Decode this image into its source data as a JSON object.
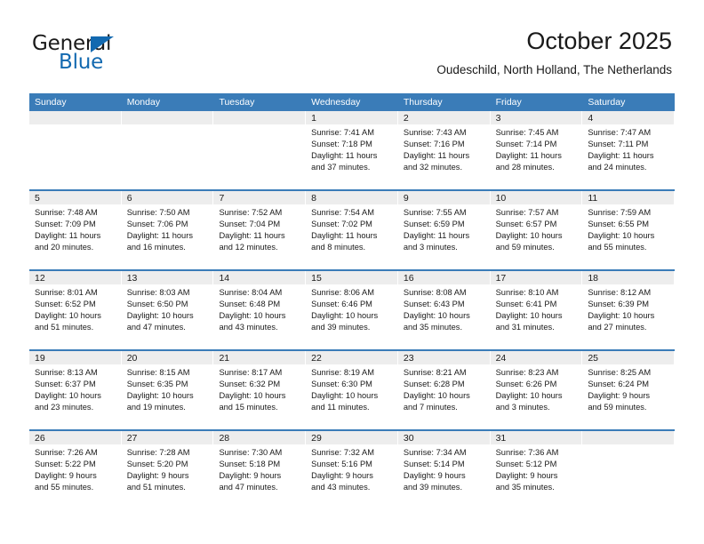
{
  "brand": {
    "name_part1": "General",
    "name_part2": "Blue",
    "accent_color": "#1269b0"
  },
  "header": {
    "title": "October 2025",
    "subtitle": "Oudeschild, North Holland, The Netherlands"
  },
  "calendar": {
    "header_color": "#3a7cb8",
    "day_band_color": "#ededed",
    "weekdays": [
      "Sunday",
      "Monday",
      "Tuesday",
      "Wednesday",
      "Thursday",
      "Friday",
      "Saturday"
    ],
    "weeks": [
      [
        {
          "day": "",
          "lines": []
        },
        {
          "day": "",
          "lines": []
        },
        {
          "day": "",
          "lines": []
        },
        {
          "day": "1",
          "lines": [
            "Sunrise: 7:41 AM",
            "Sunset: 7:18 PM",
            "Daylight: 11 hours",
            "and 37 minutes."
          ]
        },
        {
          "day": "2",
          "lines": [
            "Sunrise: 7:43 AM",
            "Sunset: 7:16 PM",
            "Daylight: 11 hours",
            "and 32 minutes."
          ]
        },
        {
          "day": "3",
          "lines": [
            "Sunrise: 7:45 AM",
            "Sunset: 7:14 PM",
            "Daylight: 11 hours",
            "and 28 minutes."
          ]
        },
        {
          "day": "4",
          "lines": [
            "Sunrise: 7:47 AM",
            "Sunset: 7:11 PM",
            "Daylight: 11 hours",
            "and 24 minutes."
          ]
        }
      ],
      [
        {
          "day": "5",
          "lines": [
            "Sunrise: 7:48 AM",
            "Sunset: 7:09 PM",
            "Daylight: 11 hours",
            "and 20 minutes."
          ]
        },
        {
          "day": "6",
          "lines": [
            "Sunrise: 7:50 AM",
            "Sunset: 7:06 PM",
            "Daylight: 11 hours",
            "and 16 minutes."
          ]
        },
        {
          "day": "7",
          "lines": [
            "Sunrise: 7:52 AM",
            "Sunset: 7:04 PM",
            "Daylight: 11 hours",
            "and 12 minutes."
          ]
        },
        {
          "day": "8",
          "lines": [
            "Sunrise: 7:54 AM",
            "Sunset: 7:02 PM",
            "Daylight: 11 hours",
            "and 8 minutes."
          ]
        },
        {
          "day": "9",
          "lines": [
            "Sunrise: 7:55 AM",
            "Sunset: 6:59 PM",
            "Daylight: 11 hours",
            "and 3 minutes."
          ]
        },
        {
          "day": "10",
          "lines": [
            "Sunrise: 7:57 AM",
            "Sunset: 6:57 PM",
            "Daylight: 10 hours",
            "and 59 minutes."
          ]
        },
        {
          "day": "11",
          "lines": [
            "Sunrise: 7:59 AM",
            "Sunset: 6:55 PM",
            "Daylight: 10 hours",
            "and 55 minutes."
          ]
        }
      ],
      [
        {
          "day": "12",
          "lines": [
            "Sunrise: 8:01 AM",
            "Sunset: 6:52 PM",
            "Daylight: 10 hours",
            "and 51 minutes."
          ]
        },
        {
          "day": "13",
          "lines": [
            "Sunrise: 8:03 AM",
            "Sunset: 6:50 PM",
            "Daylight: 10 hours",
            "and 47 minutes."
          ]
        },
        {
          "day": "14",
          "lines": [
            "Sunrise: 8:04 AM",
            "Sunset: 6:48 PM",
            "Daylight: 10 hours",
            "and 43 minutes."
          ]
        },
        {
          "day": "15",
          "lines": [
            "Sunrise: 8:06 AM",
            "Sunset: 6:46 PM",
            "Daylight: 10 hours",
            "and 39 minutes."
          ]
        },
        {
          "day": "16",
          "lines": [
            "Sunrise: 8:08 AM",
            "Sunset: 6:43 PM",
            "Daylight: 10 hours",
            "and 35 minutes."
          ]
        },
        {
          "day": "17",
          "lines": [
            "Sunrise: 8:10 AM",
            "Sunset: 6:41 PM",
            "Daylight: 10 hours",
            "and 31 minutes."
          ]
        },
        {
          "day": "18",
          "lines": [
            "Sunrise: 8:12 AM",
            "Sunset: 6:39 PM",
            "Daylight: 10 hours",
            "and 27 minutes."
          ]
        }
      ],
      [
        {
          "day": "19",
          "lines": [
            "Sunrise: 8:13 AM",
            "Sunset: 6:37 PM",
            "Daylight: 10 hours",
            "and 23 minutes."
          ]
        },
        {
          "day": "20",
          "lines": [
            "Sunrise: 8:15 AM",
            "Sunset: 6:35 PM",
            "Daylight: 10 hours",
            "and 19 minutes."
          ]
        },
        {
          "day": "21",
          "lines": [
            "Sunrise: 8:17 AM",
            "Sunset: 6:32 PM",
            "Daylight: 10 hours",
            "and 15 minutes."
          ]
        },
        {
          "day": "22",
          "lines": [
            "Sunrise: 8:19 AM",
            "Sunset: 6:30 PM",
            "Daylight: 10 hours",
            "and 11 minutes."
          ]
        },
        {
          "day": "23",
          "lines": [
            "Sunrise: 8:21 AM",
            "Sunset: 6:28 PM",
            "Daylight: 10 hours",
            "and 7 minutes."
          ]
        },
        {
          "day": "24",
          "lines": [
            "Sunrise: 8:23 AM",
            "Sunset: 6:26 PM",
            "Daylight: 10 hours",
            "and 3 minutes."
          ]
        },
        {
          "day": "25",
          "lines": [
            "Sunrise: 8:25 AM",
            "Sunset: 6:24 PM",
            "Daylight: 9 hours",
            "and 59 minutes."
          ]
        }
      ],
      [
        {
          "day": "26",
          "lines": [
            "Sunrise: 7:26 AM",
            "Sunset: 5:22 PM",
            "Daylight: 9 hours",
            "and 55 minutes."
          ]
        },
        {
          "day": "27",
          "lines": [
            "Sunrise: 7:28 AM",
            "Sunset: 5:20 PM",
            "Daylight: 9 hours",
            "and 51 minutes."
          ]
        },
        {
          "day": "28",
          "lines": [
            "Sunrise: 7:30 AM",
            "Sunset: 5:18 PM",
            "Daylight: 9 hours",
            "and 47 minutes."
          ]
        },
        {
          "day": "29",
          "lines": [
            "Sunrise: 7:32 AM",
            "Sunset: 5:16 PM",
            "Daylight: 9 hours",
            "and 43 minutes."
          ]
        },
        {
          "day": "30",
          "lines": [
            "Sunrise: 7:34 AM",
            "Sunset: 5:14 PM",
            "Daylight: 9 hours",
            "and 39 minutes."
          ]
        },
        {
          "day": "31",
          "lines": [
            "Sunrise: 7:36 AM",
            "Sunset: 5:12 PM",
            "Daylight: 9 hours",
            "and 35 minutes."
          ]
        },
        {
          "day": "",
          "lines": []
        }
      ]
    ]
  }
}
